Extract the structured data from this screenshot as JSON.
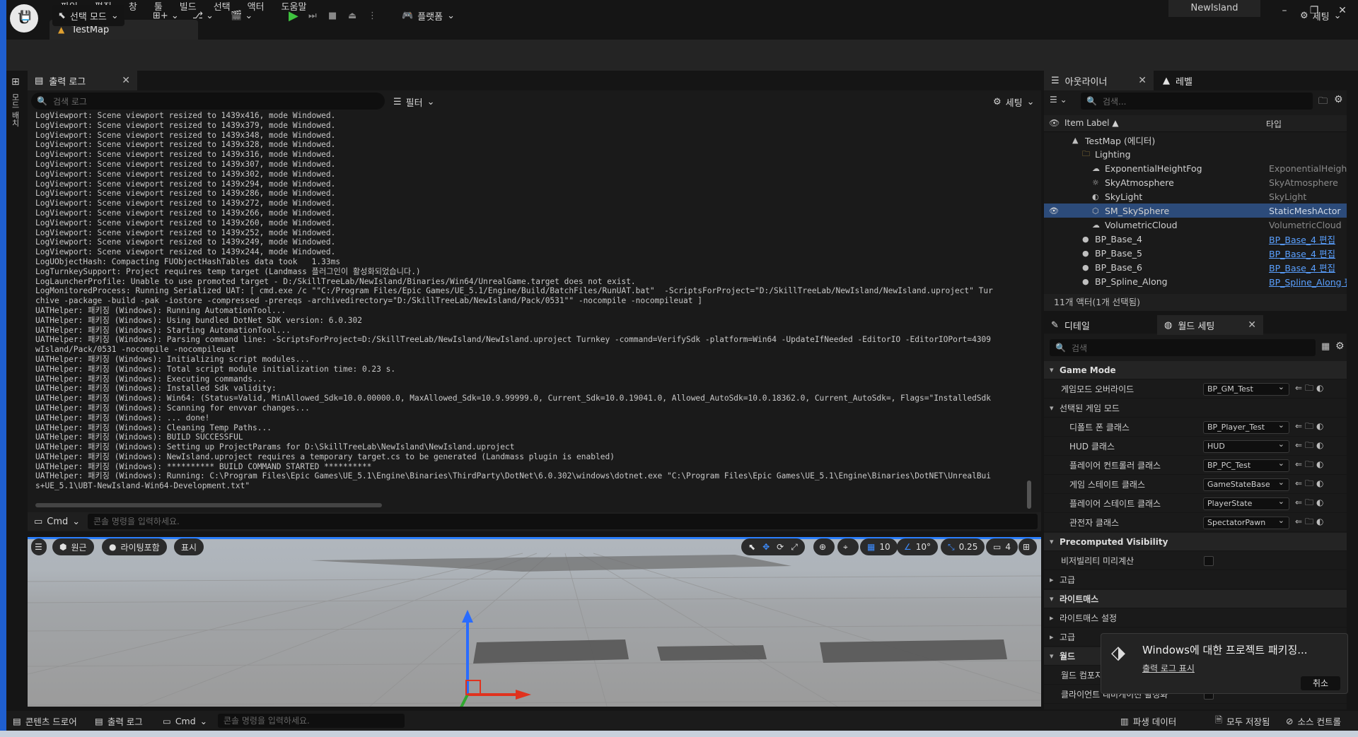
{
  "title_bar": {
    "menus": [
      "파일",
      "편집",
      "창",
      "툴",
      "빌드",
      "선택",
      "액터",
      "도움말"
    ],
    "project_name": "NewIsland",
    "doc_tab": "TestMap"
  },
  "toolbar": {
    "mode": "선택 모드",
    "platform": "플랫폼",
    "settings": "세팅"
  },
  "output_log": {
    "tab_label": "출력 로그",
    "search_placeholder": "검색 로그",
    "filter": "필터",
    "settings": "세팅",
    "lines": [
      "LogViewport: Scene viewport resized to 1439x416, mode Windowed.",
      "LogViewport: Scene viewport resized to 1439x379, mode Windowed.",
      "LogViewport: Scene viewport resized to 1439x348, mode Windowed.",
      "LogViewport: Scene viewport resized to 1439x328, mode Windowed.",
      "LogViewport: Scene viewport resized to 1439x316, mode Windowed.",
      "LogViewport: Scene viewport resized to 1439x307, mode Windowed.",
      "LogViewport: Scene viewport resized to 1439x302, mode Windowed.",
      "LogViewport: Scene viewport resized to 1439x294, mode Windowed.",
      "LogViewport: Scene viewport resized to 1439x286, mode Windowed.",
      "LogViewport: Scene viewport resized to 1439x272, mode Windowed.",
      "LogViewport: Scene viewport resized to 1439x266, mode Windowed.",
      "LogViewport: Scene viewport resized to 1439x260, mode Windowed.",
      "LogViewport: Scene viewport resized to 1439x252, mode Windowed.",
      "LogViewport: Scene viewport resized to 1439x249, mode Windowed.",
      "LogViewport: Scene viewport resized to 1439x244, mode Windowed.",
      "LogUObjectHash: Compacting FUObjectHashTables data took   1.33ms",
      "LogTurnkeySupport: Project requires temp target (Landmass 플러그인이 활성화되었습니다.)",
      "LogLauncherProfile: Unable to use promoted target - D:/SkillTreeLab/NewIsland/Binaries/Win64/UnrealGame.target does not exist.",
      "LogMonitoredProcess: Running Serialized UAT: [ cmd.exe /c \"\"C:/Program Files/Epic Games/UE_5.1/Engine/Build/BatchFiles/RunUAT.bat\"  -ScriptsForProject=\"D:/SkillTreeLab/NewIsland/NewIsland.uproject\" Tur",
      "chive -package -build -pak -iostore -compressed -prereqs -archivedirectory=\"D:/SkillTreeLab/NewIsland/Pack/0531\"\" -nocompile -nocompileuat ]",
      "UATHelper: 패키징 (Windows): Running AutomationTool...",
      "UATHelper: 패키징 (Windows): Using bundled DotNet SDK version: 6.0.302",
      "UATHelper: 패키징 (Windows): Starting AutomationTool...",
      "UATHelper: 패키징 (Windows): Parsing command line: -ScriptsForProject=D:/SkillTreeLab/NewIsland/NewIsland.uproject Turnkey -command=VerifySdk -platform=Win64 -UpdateIfNeeded -EditorIO -EditorIOPort=4309",
      "wIsland/Pack/0531 -nocompile -nocompileuat",
      "UATHelper: 패키징 (Windows): Initializing script modules...",
      "UATHelper: 패키징 (Windows): Total script module initialization time: 0.23 s.",
      "UATHelper: 패키징 (Windows): Executing commands...",
      "UATHelper: 패키징 (Windows): Installed Sdk validity:",
      "UATHelper: 패키징 (Windows): Win64: (Status=Valid, MinAllowed_Sdk=10.0.00000.0, MaxAllowed_Sdk=10.9.99999.0, Current_Sdk=10.0.19041.0, Allowed_AutoSdk=10.0.18362.0, Current_AutoSdk=, Flags=\"InstalledSdk",
      "UATHelper: 패키징 (Windows): Scanning for envvar changes...",
      "UATHelper: 패키징 (Windows): ... done!",
      "UATHelper: 패키징 (Windows): Cleaning Temp Paths...",
      "UATHelper: 패키징 (Windows): BUILD SUCCESSFUL",
      "UATHelper: 패키징 (Windows): Setting up ProjectParams for D:\\SkillTreeLab\\NewIsland\\NewIsland.uproject",
      "UATHelper: 패키징 (Windows): NewIsland.uproject requires a temporary target.cs to be generated (Landmass plugin is enabled)",
      "UATHelper: 패키징 (Windows): ********** BUILD COMMAND STARTED **********",
      "UATHelper: 패키징 (Windows): Running: C:\\Program Files\\Epic Games\\UE_5.1\\Engine\\Binaries\\ThirdParty\\DotNet\\6.0.302\\windows\\dotnet.exe \"C:\\Program Files\\Epic Games\\UE_5.1\\Engine\\Binaries\\DotNET\\UnrealBui",
      "s+UE_5.1\\UBT-NewIsland-Win64-Development.txt\""
    ],
    "cmd_label": "Cmd",
    "cmd_placeholder": "콘솔 명령을 입력하세요."
  },
  "viewport": {
    "perspective": "원근",
    "lighting": "라이팅포함",
    "show": "표시",
    "grid_snap": "10",
    "rotate_snap": "10°",
    "scale_snap": "0.25",
    "camera_speed": "4"
  },
  "outliner": {
    "tab_label": "아웃라이너",
    "levels_tab": "레벨",
    "search_placeholder": "검색...",
    "col_label": "Item Label ▲",
    "col_type": "타입",
    "items": [
      {
        "label": "TestMap (에디터)",
        "type": "",
        "indent": 0,
        "icon": "map-icon"
      },
      {
        "label": "Lighting",
        "type": "",
        "indent": 1,
        "icon": "folder-icon"
      },
      {
        "label": "ExponentialHeightFog",
        "type": "ExponentialHeightF",
        "indent": 2,
        "icon": "fog-icon"
      },
      {
        "label": "SkyAtmosphere",
        "type": "SkyAtmosphere",
        "indent": 2,
        "icon": "sky-icon"
      },
      {
        "label": "SkyLight",
        "type": "SkyLight",
        "indent": 2,
        "icon": "skylight-icon"
      },
      {
        "label": "SM_SkySphere",
        "type": "StaticMeshActor",
        "indent": 2,
        "icon": "mesh-icon",
        "selected": true
      },
      {
        "label": "VolumetricCloud",
        "type": "VolumetricCloud",
        "indent": 2,
        "icon": "cloud-icon"
      },
      {
        "label": "BP_Base_4",
        "type": "BP_Base_4 편집",
        "indent": 1,
        "icon": "actor-icon",
        "link": true
      },
      {
        "label": "BP_Base_5",
        "type": "BP_Base_4 편집",
        "indent": 1,
        "icon": "actor-icon",
        "link": true
      },
      {
        "label": "BP_Base_6",
        "type": "BP_Base_4 편집",
        "indent": 1,
        "icon": "actor-icon",
        "link": true
      },
      {
        "label": "BP_Spline_Along",
        "type": "BP_Spline_Along 편",
        "indent": 1,
        "icon": "actor-icon",
        "link": true
      }
    ],
    "footer": "11개 액터(1개 선택됨)"
  },
  "details": {
    "tab_label": "디테일",
    "world_settings_tab": "월드 세팅",
    "search_placeholder": "검색",
    "rows": [
      {
        "kind": "section",
        "label": "Game Mode"
      },
      {
        "kind": "prop",
        "label": "게임모드 오버라이드",
        "value": "BP_GM_Test",
        "indent": 1
      },
      {
        "kind": "subsection",
        "label": "선택된 게임 모드"
      },
      {
        "kind": "prop",
        "label": "디폴트 폰 클래스",
        "value": "BP_Player_Test",
        "indent": 2
      },
      {
        "kind": "prop",
        "label": "HUD 클래스",
        "value": "HUD",
        "indent": 2
      },
      {
        "kind": "prop",
        "label": "플레이어 컨트롤러 클래스",
        "value": "BP_PC_Test",
        "indent": 2
      },
      {
        "kind": "prop",
        "label": "게임 스테이트 클래스",
        "value": "GameStateBase",
        "indent": 2
      },
      {
        "kind": "prop",
        "label": "플레이어 스테이트 클래스",
        "value": "PlayerState",
        "indent": 2
      },
      {
        "kind": "prop",
        "label": "관전자 클래스",
        "value": "SpectatorPawn",
        "indent": 2
      },
      {
        "kind": "section",
        "label": "Precomputed Visibility"
      },
      {
        "kind": "check",
        "label": "비저빌리티 미리계산",
        "indent": 1
      },
      {
        "kind": "collapsed",
        "label": "고급"
      },
      {
        "kind": "section",
        "label": "라이트매스"
      },
      {
        "kind": "collapsed",
        "label": "라이트매스 설정"
      },
      {
        "kind": "collapsed",
        "label": "고급"
      },
      {
        "kind": "section",
        "label": "월드"
      },
      {
        "kind": "prop-partial",
        "label": "월드 컴포지",
        "indent": 1
      },
      {
        "kind": "check",
        "label": "클라이언트 네비게이션 활성화",
        "indent": 1
      }
    ]
  },
  "toast": {
    "title": "Windows에 대한 프로젝트 패키징...",
    "link": "출력 로그 표시",
    "cancel": "취소"
  },
  "status_bar": {
    "content_drawer": "콘텐츠 드로어",
    "output_log": "출력 로그",
    "cmd": "Cmd",
    "cmd_placeholder": "콘솔 명령을 입력하세요.",
    "derived_data": "파생 데이터",
    "save_all": "모두 저장됨",
    "source_control": "소스 컨트롤"
  },
  "left_dock_label": "모드 배치"
}
